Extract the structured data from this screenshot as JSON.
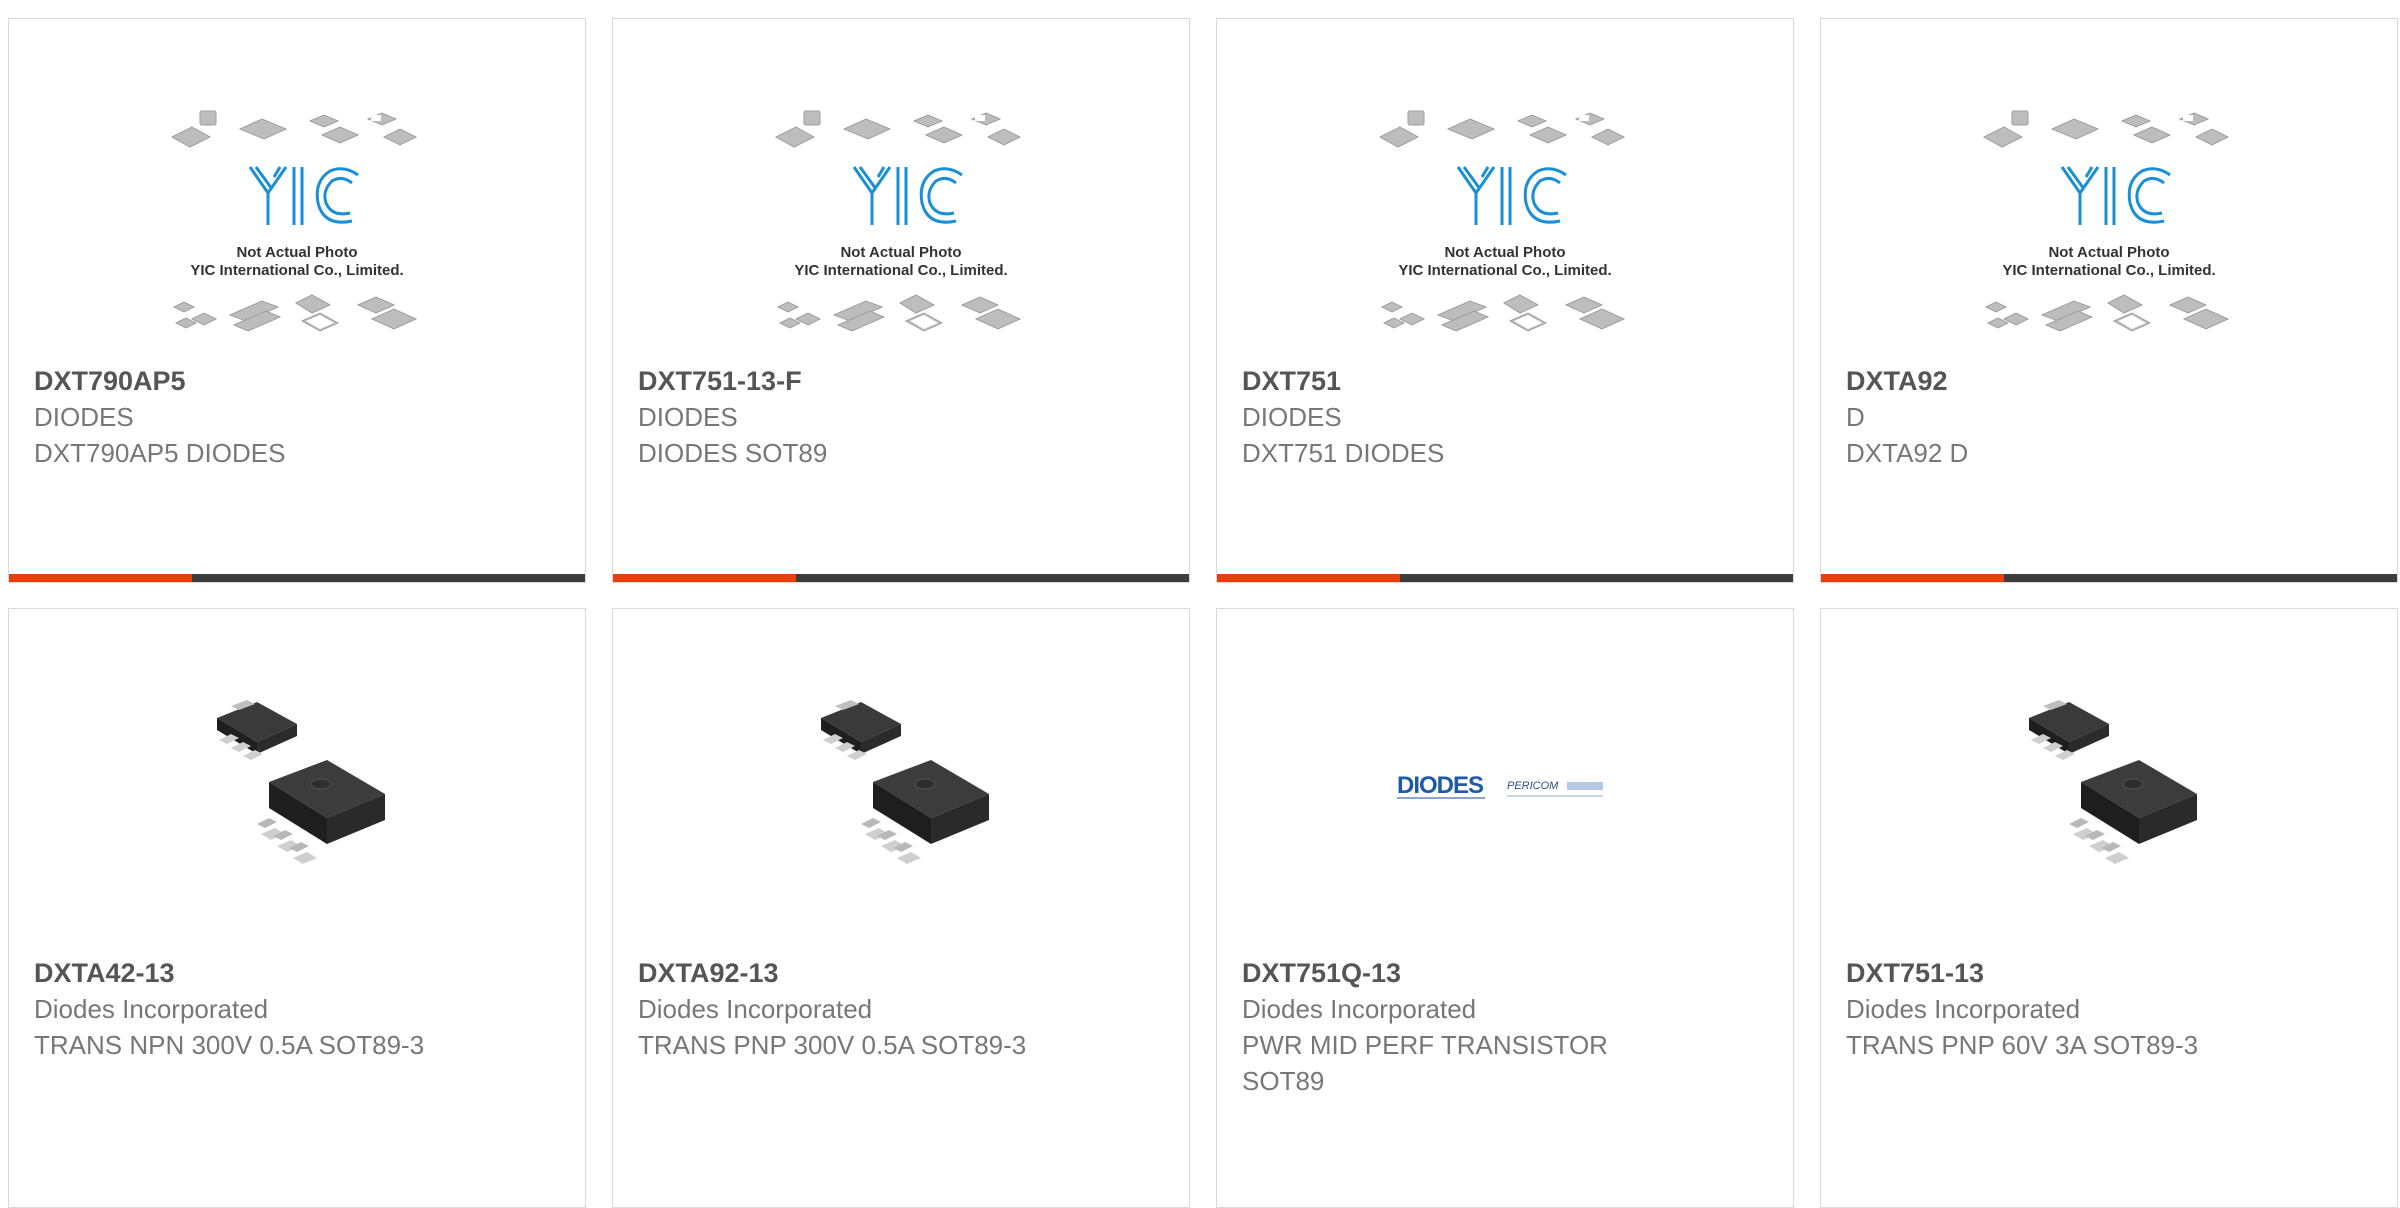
{
  "colors": {
    "accent": "#e8400c",
    "bar": "#3d3d3d",
    "part_text": "#555555",
    "sub_text": "#777777",
    "yic_blue": "#1a8fd6",
    "diodes_blue": "#1f5aa6"
  },
  "yic_logo": {
    "brand": "YIC",
    "line1": "Not Actual Photo",
    "line2": "YIC International Co., Limited."
  },
  "diodes_logo": {
    "brand": "DIODES",
    "sub": "PERICOM"
  },
  "products": [
    {
      "part": "DXT790AP5",
      "mfr": "DIODES",
      "desc": "DXT790AP5 DIODES",
      "image": "yic-placeholder"
    },
    {
      "part": "DXT751-13-F",
      "mfr": "DIODES",
      "desc": "DIODES SOT89",
      "image": "yic-placeholder"
    },
    {
      "part": "DXT751",
      "mfr": "DIODES",
      "desc": "DXT751 DIODES",
      "image": "yic-placeholder"
    },
    {
      "part": "DXTA92",
      "mfr": "D",
      "desc": "DXTA92 D",
      "image": "yic-placeholder"
    },
    {
      "part": "DXTA42-13",
      "mfr": "Diodes Incorporated",
      "desc": "TRANS NPN 300V 0.5A SOT89-3",
      "image": "sot89-chip"
    },
    {
      "part": "DXTA92-13",
      "mfr": "Diodes Incorporated",
      "desc": "TRANS PNP 300V 0.5A SOT89-3",
      "image": "sot89-chip"
    },
    {
      "part": "DXT751Q-13",
      "mfr": "Diodes Incorporated",
      "desc": "PWR MID PERF TRANSISTOR SOT89",
      "image": "diodes-logo"
    },
    {
      "part": "DXT751-13",
      "mfr": "Diodes Incorporated",
      "desc": "TRANS PNP 60V 3A SOT89-3",
      "image": "sot89-chip"
    }
  ]
}
